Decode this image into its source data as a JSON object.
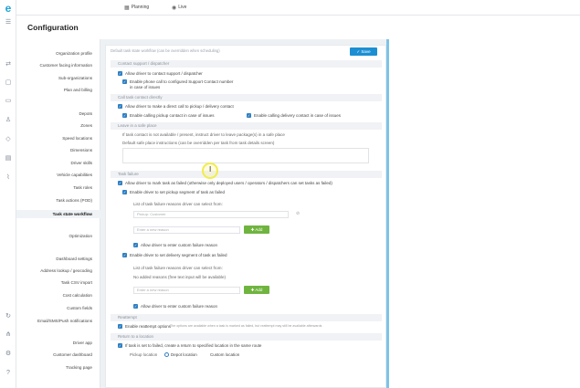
{
  "topbar": {
    "tabs": [
      {
        "label": "Planning",
        "icon": "calendar-icon"
      },
      {
        "label": "Live",
        "icon": "signal-icon"
      }
    ]
  },
  "page": {
    "title": "Configuration"
  },
  "sidebar": {
    "items": [
      {
        "label": "Organization profile"
      },
      {
        "label": "Customer facing information"
      },
      {
        "label": "Sub-organizations"
      },
      {
        "label": "Plan and billing"
      },
      {
        "label": "Depots"
      },
      {
        "label": "Zones"
      },
      {
        "label": "Speed locations"
      },
      {
        "label": "Dimensions"
      },
      {
        "label": "Driver skills"
      },
      {
        "label": "Vehicle capabilities"
      },
      {
        "label": "Task roles"
      },
      {
        "label": "Task actions (POD)"
      },
      {
        "label": "Task state workflow"
      },
      {
        "label": "Optimization"
      },
      {
        "label": "Dashboard settings"
      },
      {
        "label": "Address lookup / geocoding"
      },
      {
        "label": "Task CSV import"
      },
      {
        "label": "Cost calculation"
      },
      {
        "label": "Custom fields"
      },
      {
        "label": "Email/SMS/Push notifications"
      },
      {
        "label": "Driver app"
      },
      {
        "label": "Customer dashboard"
      },
      {
        "label": "Tracking page"
      }
    ],
    "active_index": 12
  },
  "form": {
    "header_hint": "Default task state workflow (can be overridden when scheduling)",
    "save_label": "Save",
    "sections": {
      "contact_support": "Contact support / dispatcher",
      "call_contact": "Call task contact directly",
      "safe_place": "Leave in a safe place",
      "task_failure": "Task failure",
      "reattempt": "Reattempt",
      "return": "Return to a location"
    },
    "allow_contact_support": "Allow driver to contact support / dispatcher",
    "enable_phone_call": "Enable phone call to configured Support Contact number",
    "in_case_of_issues": "in case of issues",
    "allow_direct_call": "Allow driver to make a direct call to pickup / delivery contact",
    "enable_calling_pickup": "Enable calling pickup contact in case of issues",
    "enable_calling_delivery": "Enable calling delivery contact in case of issues",
    "safe_place_note": "If task contact is not available / present, instruct driver to leave package(s) in a safe place",
    "safe_place_default_label": "Default safe place instructions (can be overridden per task from task details screen)",
    "safe_place_textarea_value": "",
    "allow_mark_failed": "Allow driver to mark task as failed (otherwise only deployed users / operators / dispatchers can set tasks as failed)",
    "enable_pickup_failed": "Enable driver to set pickup segment of task as failed",
    "pickup_reasons_label": "List of task failure reasons driver can select from:",
    "pickup_reason_existing": "Pickup: Customer",
    "pickup_new_reason_placeholder": "Enter a new reason",
    "add_label": "Add",
    "allow_custom_pickup": "Allow driver to enter custom failure reason",
    "enable_delivery_failed": "Enable driver to set delivery segment of task as failed",
    "delivery_reasons_label": "List of task failure reasons driver can select from:",
    "delivery_no_reasons": "No added reasons (free text input will be available)",
    "delivery_new_reason_placeholder": "Enter a new reason",
    "allow_custom_delivery": "Allow driver to enter custom failure reason",
    "enable_reattempt": "Enable reattempt options",
    "reattempt_note": "The options are available when a task is marked as failed, but reattempt may still be available afterwards",
    "return_option": "If task is set to failed, create a return to specified location in the same route",
    "pickup_location_label": "Pickup location",
    "radio_depot": "Depot location",
    "radio_custom": "Custom location"
  },
  "colors": {
    "accent": "#1c8fd3",
    "add_button": "#6fb43f",
    "checkbox": "#2e7fc2",
    "brand_logo": "#21a3d8"
  },
  "rail_icons": [
    "menu-icon",
    "route-icon",
    "box-icon",
    "truck-icon",
    "driver-icon",
    "tag-icon",
    "message-icon",
    "chart-icon",
    "sync-icon",
    "network-icon",
    "settings-icon",
    "help-icon"
  ]
}
